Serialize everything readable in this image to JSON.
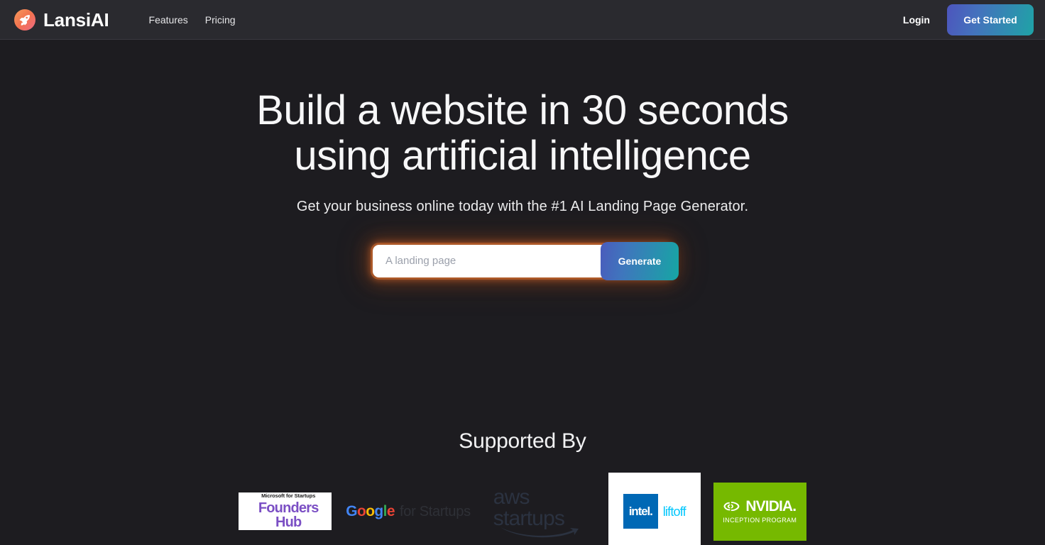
{
  "header": {
    "brand": {
      "name": "LansiAI",
      "icon": "rocket-icon"
    },
    "nav": [
      {
        "label": "Features"
      },
      {
        "label": "Pricing"
      }
    ],
    "login_label": "Login",
    "cta_label": "Get Started",
    "cta_gradient_from": "#4d55bd",
    "cta_gradient_to": "#1fa3a6"
  },
  "hero": {
    "title_line1": "Build a website in 30 seconds using",
    "title_line2": "artificial intelligence",
    "title": "Build a website in 30 seconds using artificial intelligence",
    "subtitle": "Get your business online today with the #1 AI Landing Page Generator."
  },
  "generator": {
    "input_value": "",
    "input_placeholder": "A landing page",
    "button_label": "Generate",
    "glow_color": "#d06c30",
    "button_gradient_from": "#4a5bbc",
    "button_gradient_to": "#16a6a4"
  },
  "supported": {
    "title": "Supported By",
    "logos": [
      {
        "name": "microsoft-founders-hub",
        "line1": "Microsoft for Startups",
        "line2": "Founders Hub",
        "color": "#7b4fc4",
        "card_bg": "#ffffff"
      },
      {
        "name": "google-for-startups",
        "word": "Google",
        "letters": [
          "G",
          "o",
          "o",
          "g",
          "l",
          "e"
        ],
        "suffix": "for Startups",
        "card_bg": "transparent"
      },
      {
        "name": "aws-startups",
        "text": "aws startups",
        "color": "#2b3240",
        "card_bg": "transparent"
      },
      {
        "name": "intel-liftoff",
        "brand": "intel.",
        "program": "liftoff",
        "square_color": "#0068b5",
        "program_color": "#00c7fd",
        "card_bg": "#ffffff"
      },
      {
        "name": "nvidia-inception-program",
        "brand": "NVIDIA.",
        "program": "INCEPTION PROGRAM",
        "card_bg": "#76b900"
      }
    ]
  },
  "theme": {
    "page_bg": "#1d1c20",
    "header_bg": "#2a2a2f"
  }
}
